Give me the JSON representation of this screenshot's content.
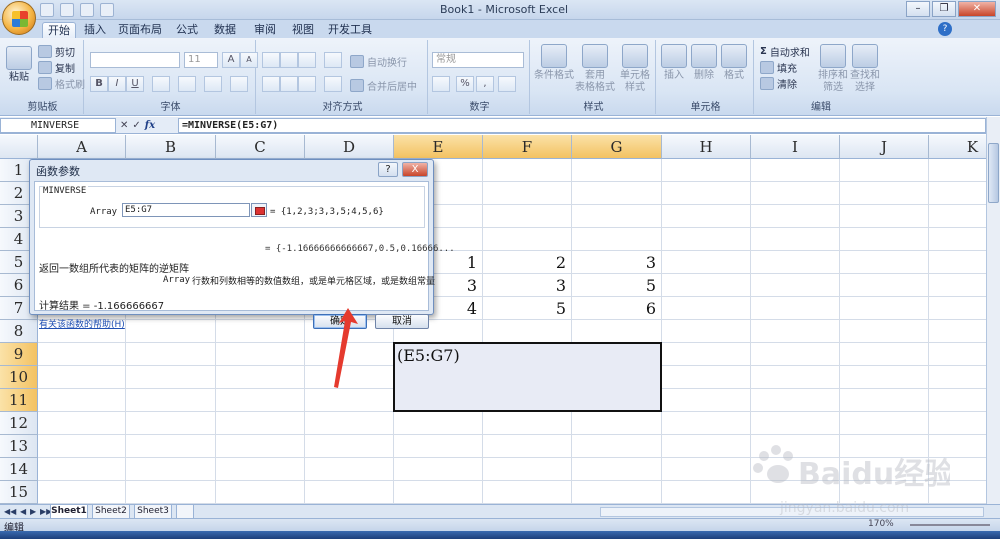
{
  "window": {
    "title": "Book1 - Microsoft Excel"
  },
  "tabs": [
    "开始",
    "插入",
    "页面布局",
    "公式",
    "数据",
    "审阅",
    "视图",
    "开发工具"
  ],
  "ribbon": {
    "clipboard": {
      "paste": "粘贴",
      "cut": "剪切",
      "copy": "复制",
      "format_painter": "格式刷",
      "label": "剪贴板"
    },
    "font": {
      "size": "11",
      "bold": "B",
      "italic": "I",
      "underline": "U",
      "label": "字体"
    },
    "alignment": {
      "wrap": "自动换行",
      "merge": "合并后居中",
      "label": "对齐方式"
    },
    "number": {
      "format": "常规",
      "percent": "%",
      "comma": ",",
      "label": "数字"
    },
    "styles": {
      "conditional": "条件格式",
      "table": "套用\n表格格式",
      "cell_styles": "单元格\n样式",
      "label": "样式"
    },
    "cells": {
      "insert": "插入",
      "delete": "删除",
      "format": "格式",
      "label": "单元格"
    },
    "editing": {
      "autosum": "自动求和",
      "fill": "填充",
      "clear": "清除",
      "sort": "排序和\n筛选",
      "find": "查找和\n选择",
      "label": "编辑"
    }
  },
  "formula_bar": {
    "name_box": "MINVERSE",
    "fx": "fx",
    "formula": "=MINVERSE(E5:G7)"
  },
  "grid": {
    "columns": [
      "A",
      "B",
      "C",
      "D",
      "E",
      "F",
      "G",
      "H",
      "I",
      "J",
      "K"
    ],
    "rows": [
      "1",
      "2",
      "3",
      "4",
      "5",
      "6",
      "7",
      "8",
      "9",
      "10",
      "11",
      "12",
      "13",
      "14",
      "15"
    ],
    "cells": [
      {
        "ref": "E5",
        "value": "1"
      },
      {
        "ref": "F5",
        "value": "2"
      },
      {
        "ref": "G5",
        "value": "3"
      },
      {
        "ref": "E6",
        "value": "3"
      },
      {
        "ref": "F6",
        "value": "3"
      },
      {
        "ref": "G6",
        "value": "5"
      },
      {
        "ref": "E7",
        "value": "4"
      },
      {
        "ref": "F7",
        "value": "5"
      },
      {
        "ref": "G7",
        "value": "6"
      }
    ],
    "selection_text": "(E5:G7)"
  },
  "dialog": {
    "title": "函数参数",
    "help_glyph": "?",
    "close_glyph": "X",
    "function_name": "MINVERSE",
    "arg_label": "Array",
    "arg_value": "E5:G7",
    "arg_eval": "=  {1,2,3;3,3,5;4,5,6}",
    "result_preview": "=  {-1.16666666666667,0.5,0.16666...",
    "description": "返回一数组所代表的矩阵的逆矩阵",
    "arg_desc_name": "Array",
    "arg_desc": "行数和列数相等的数值数组，或是单元格区域，或是数组常量",
    "calc_result": "计算结果 =  -1.166666667",
    "help_link": "有关该函数的帮助(H)",
    "ok": "确定",
    "cancel": "取消"
  },
  "sheets": [
    "Sheet1",
    "Sheet2",
    "Sheet3"
  ],
  "status": {
    "mode": "编辑",
    "zoom": "170%"
  },
  "watermark": {
    "text": "Baidu经验",
    "url": "jingyan.baidu.com"
  }
}
